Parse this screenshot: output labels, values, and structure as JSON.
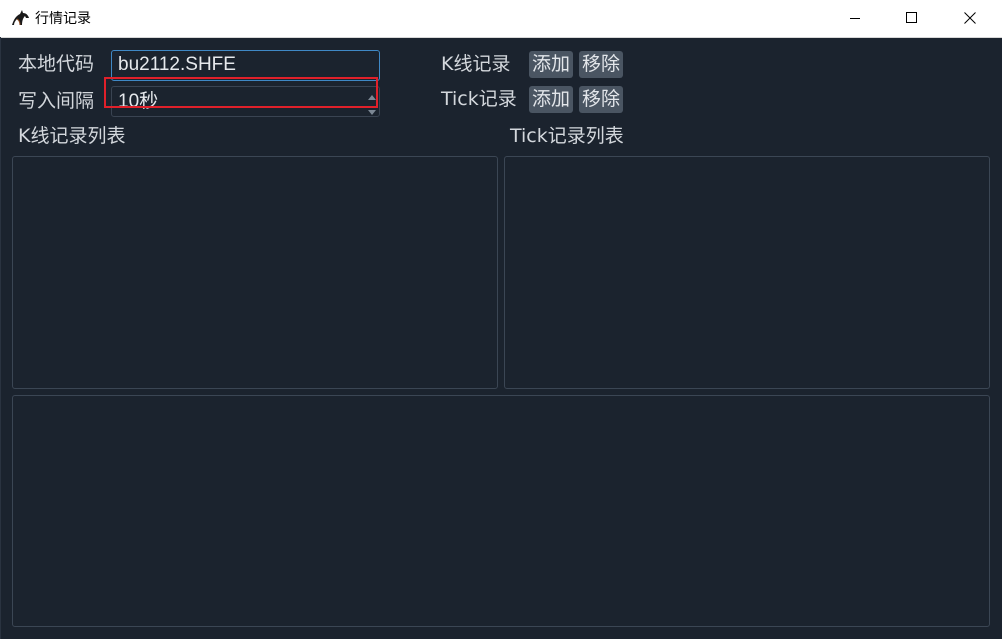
{
  "window": {
    "title": "行情记录",
    "icon": "horse-logo-icon",
    "controls": [
      "minimize-icon",
      "maximize-icon",
      "close-icon"
    ]
  },
  "form": {
    "local_code_label": "本地代码",
    "local_code_value": "bu2112.SHFE",
    "write_interval_label": "写入间隔",
    "write_interval_value": "10秒"
  },
  "kline": {
    "label": "K线记录",
    "add_label": "添加",
    "remove_label": "移除",
    "list_title": "K线记录列表"
  },
  "tick": {
    "label": "Tick记录",
    "add_label": "添加",
    "remove_label": "移除",
    "list_title": "Tick记录列表"
  },
  "colors": {
    "background": "#1b232e",
    "accent_border": "#3f88c5",
    "highlight": "#e0202a",
    "button_bg": "#4a5562"
  }
}
